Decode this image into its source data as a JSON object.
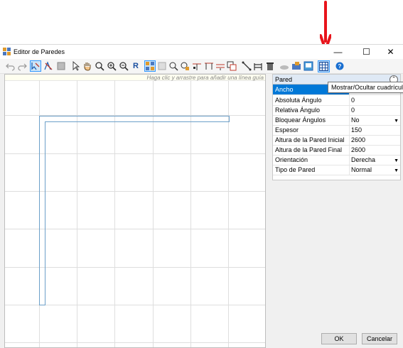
{
  "window": {
    "title": "Editor de Paredes",
    "minimize": "—",
    "maximize": "☐",
    "close": "✕"
  },
  "toolbar": {
    "icons": [
      "undo-icon",
      "redo-icon",
      "select-wall-icon",
      "erase-icon",
      "block-icon",
      "pointer-icon",
      "hand-icon",
      "zoom-window-icon",
      "zoom-in-icon",
      "zoom-out-icon",
      "refresh-R-icon",
      "wall-tool-icon",
      "wall-tool-2-icon",
      "rotate-icon",
      "select-all-icon",
      "split-icon",
      "join-icon",
      "offset-icon",
      "copy-icon",
      "measure-icon",
      "fence-icon",
      "trash-icon",
      "cloud-icon",
      "folder-icon",
      "image-icon",
      "grid-toggle-icon",
      "help-icon"
    ],
    "refresh_label": "R"
  },
  "canvas": {
    "hint": "Haga clic y arrastre para añadir una línea guía"
  },
  "properties": {
    "header": "Pared",
    "rows": [
      {
        "label": "Ancho",
        "value": ""
      },
      {
        "label": "Absoluta Ángulo",
        "value": "0"
      },
      {
        "label": "Relativa Ángulo",
        "value": "0"
      },
      {
        "label": "Bloquear Ángulos",
        "value": "No"
      },
      {
        "label": "Espesor",
        "value": "150"
      },
      {
        "label": "Altura de la Pared Inicial",
        "value": "2600"
      },
      {
        "label": "Altura de la Pared Final",
        "value": "2600"
      },
      {
        "label": "Orientación",
        "value": "Derecha"
      },
      {
        "label": "Tipo de Pared",
        "value": "Normal"
      }
    ]
  },
  "tooltip": "Mostrar/Ocultar cuadrícula",
  "buttons": {
    "ok": "OK",
    "cancel": "Cancelar"
  },
  "colors": {
    "arrow": "#e8141b",
    "selection": "#0078d7",
    "wall": "#6ca0c9"
  }
}
